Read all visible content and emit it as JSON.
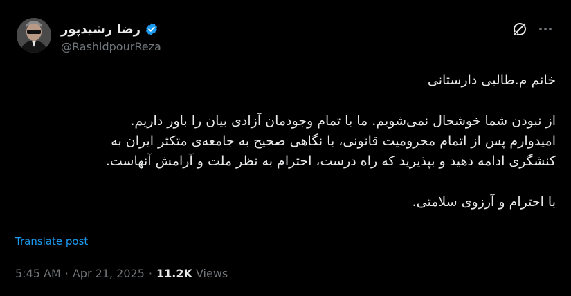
{
  "author": {
    "display_name": "رضا رشیدپور",
    "handle": "@RashidpourReza",
    "verified_color": "#1d9bf0"
  },
  "icons": {
    "verified": "verified-badge-icon",
    "grok": "grok-icon",
    "more": "more-options-icon"
  },
  "tweet": {
    "line1": "خانم م.طالبی دارستانی",
    "para2_line1": "از نبودن شما خوشحال نمی‌شویم. ما با تمام وجودمان آزادی بیان را باور داریم.",
    "para2_line2": "امیدوارم پس از اتمام محرومیت قانونی، با نگاهی صحیح به جامعه‌ی متکثر ایران به",
    "para2_line3": "کنشگری ادامه دهید و بپذیرید که راه درست، احترام به نظر ملت و آرامش آنهاست.",
    "closing": "با احترام و آرزوی سلامتی."
  },
  "translate_label": "Translate post",
  "meta": {
    "time": "5:45 AM",
    "sep1": "·",
    "date": "Apr 21, 2025",
    "sep2": "·",
    "views_count": "11.2K",
    "views_label": "Views"
  }
}
